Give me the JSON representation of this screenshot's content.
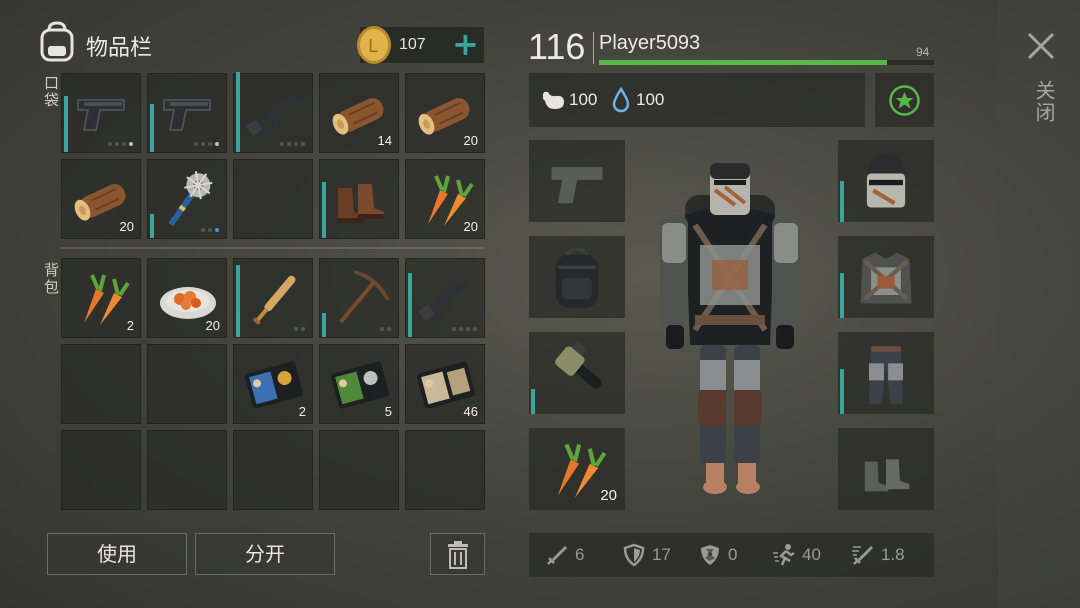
{
  "header": {
    "title": "物品栏",
    "coins": "107",
    "add_label": "+"
  },
  "sections": {
    "pockets": "口袋",
    "backpack": "背包"
  },
  "pocket_slots": [
    {
      "icon": "pistol-icon",
      "count": "",
      "durability": 0.7,
      "dots": "on-light"
    },
    {
      "icon": "pistol-icon",
      "count": "",
      "durability": 0.6,
      "dots": "on-light"
    },
    {
      "icon": "rifle-icon",
      "count": "",
      "durability": 1.0,
      "dots": "off"
    },
    {
      "icon": "log-icon",
      "count": "14"
    },
    {
      "icon": "log-icon",
      "count": "20"
    },
    {
      "icon": "log-icon",
      "count": "20"
    },
    {
      "icon": "spiked-club-icon",
      "count": "",
      "durability": 0.3,
      "dots": "blue"
    },
    {
      "icon": "",
      "count": ""
    },
    {
      "icon": "boots-icon",
      "count": "",
      "durability": 0.7
    },
    {
      "icon": "carrot-icon",
      "count": "20"
    }
  ],
  "backpack_slots": [
    {
      "icon": "carrot-icon",
      "count": "2"
    },
    {
      "icon": "food-plate-icon",
      "count": "20"
    },
    {
      "icon": "baseball-bat-icon",
      "count": "",
      "durability": 0.9,
      "dots": "two"
    },
    {
      "icon": "pickaxe-icon",
      "count": "",
      "durability": 0.3,
      "dots": "two"
    },
    {
      "icon": "rifle-icon",
      "count": "",
      "durability": 0.8,
      "dots": "four"
    },
    {
      "icon": "",
      "count": ""
    },
    {
      "icon": "",
      "count": ""
    },
    {
      "icon": "blue-id-card-icon",
      "count": "2"
    },
    {
      "icon": "green-id-card-icon",
      "count": "5"
    },
    {
      "icon": "tan-id-card-icon",
      "count": "46"
    },
    {
      "icon": "",
      "count": ""
    },
    {
      "icon": "",
      "count": ""
    },
    {
      "icon": "",
      "count": ""
    },
    {
      "icon": "",
      "count": ""
    },
    {
      "icon": "",
      "count": ""
    }
  ],
  "buttons": {
    "use": "使用",
    "split": "分开"
  },
  "player": {
    "level": "116",
    "name": "Player5093",
    "xp_to_next": "94",
    "xp_progress": 0.86
  },
  "vitals": {
    "food": "100",
    "water": "100"
  },
  "close_label": "关闭",
  "equipment": {
    "left": [
      {
        "icon": "pistol-placeholder-icon",
        "count": ""
      },
      {
        "icon": "backpack-icon",
        "count": ""
      },
      {
        "icon": "chainsaw-icon",
        "count": "",
        "durability": 0.3
      },
      {
        "icon": "carrot-icon",
        "count": "20"
      }
    ],
    "right": [
      {
        "icon": "helmet-icon",
        "count": "",
        "durability": 0.5
      },
      {
        "icon": "armor-vest-icon",
        "count": "",
        "durability": 0.55
      },
      {
        "icon": "armor-pants-icon",
        "count": "",
        "durability": 0.55
      },
      {
        "icon": "boots-placeholder-icon",
        "count": ""
      }
    ]
  },
  "stats": [
    {
      "icon": "sword-icon",
      "value": "6"
    },
    {
      "icon": "shield-icon",
      "value": "17"
    },
    {
      "icon": "radiation-icon",
      "value": "0"
    },
    {
      "icon": "running-icon",
      "value": "40"
    },
    {
      "icon": "attack-speed-icon",
      "value": "1.8"
    }
  ],
  "colors": {
    "accent_teal": "#3aa59d",
    "xp_green": "#57b847",
    "slot_bg": "#2a2c27"
  }
}
